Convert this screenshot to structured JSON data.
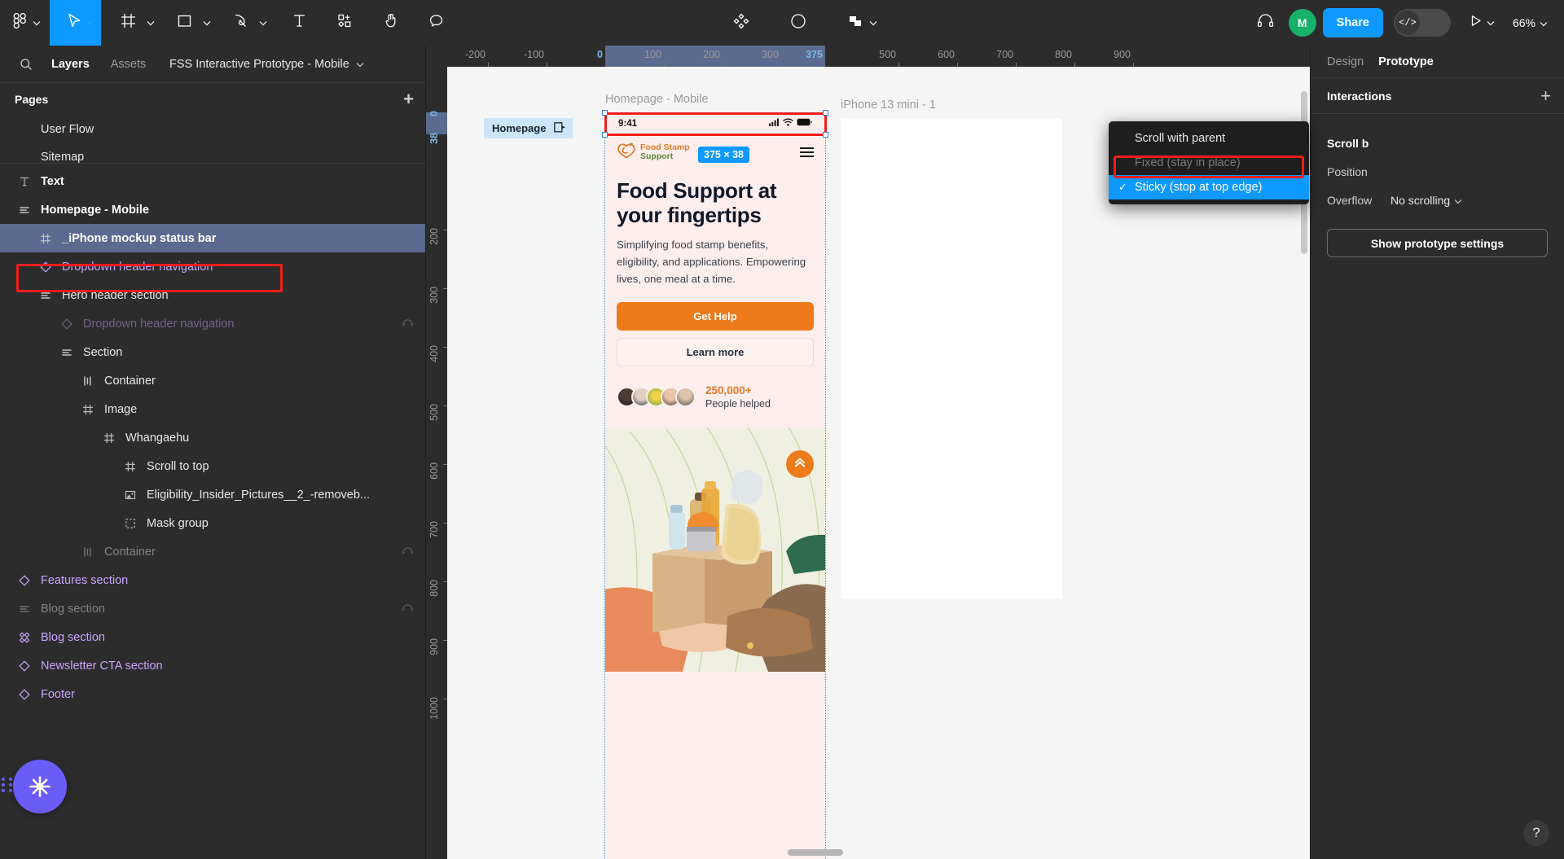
{
  "toolbar": {
    "menu_icon": "figma-logo-icon",
    "tools": [
      {
        "name": "move-tool",
        "icon": "cursor-icon",
        "active": true,
        "caret": true
      },
      {
        "name": "frame-tool",
        "icon": "frame-icon",
        "caret": true
      },
      {
        "name": "shape-tool",
        "icon": "square-icon",
        "caret": true
      },
      {
        "name": "pen-tool",
        "icon": "pen-icon",
        "caret": true
      },
      {
        "name": "text-tool",
        "icon": "text-icon",
        "caret": false
      },
      {
        "name": "actions-tool",
        "icon": "plugin-add-icon",
        "caret": false
      },
      {
        "name": "hand-tool",
        "icon": "hand-icon",
        "caret": false
      },
      {
        "name": "comment-tool",
        "icon": "comment-icon",
        "caret": false
      }
    ],
    "mid_tools": [
      {
        "name": "components-icon"
      },
      {
        "name": "contrast-icon"
      },
      {
        "name": "boolean-icon",
        "caret": true
      }
    ],
    "headphones_icon": "headphones-icon",
    "avatar_initial": "M",
    "share_label": "Share",
    "devmode_icon": "code-icon",
    "present_icon": "play-icon",
    "zoom_level": "66%"
  },
  "left_panel": {
    "search_icon": "search-icon",
    "tabs": [
      {
        "label": "Layers",
        "active": true
      },
      {
        "label": "Assets",
        "active": false
      }
    ],
    "file_name": "FSS Interactive Prototype - Mobile",
    "pages_header": "Pages",
    "pages_add_icon": "plus-icon",
    "pages": [
      {
        "label": "User Flow"
      },
      {
        "label": "Sitemap"
      }
    ],
    "layers": [
      {
        "label": "Text",
        "icon": "text-layer-icon",
        "indent": 0,
        "bold": true,
        "style": "normal"
      },
      {
        "label": "Homepage - Mobile",
        "icon": "autolayout-icon",
        "indent": 0,
        "bold": true,
        "style": "normal"
      },
      {
        "label": "_iPhone mockup status bar",
        "icon": "frame-layer-icon",
        "indent": 1,
        "bold": true,
        "style": "normal",
        "selected": true
      },
      {
        "label": "Dropdown header navigation",
        "icon": "component-icon",
        "indent": 1,
        "style": "component"
      },
      {
        "label": "Hero header section",
        "icon": "autolayout-icon",
        "indent": 1,
        "style": "normal"
      },
      {
        "label": "Dropdown header navigation",
        "icon": "component-icon",
        "indent": 2,
        "style": "component",
        "dim": true,
        "hidden_eye": true
      },
      {
        "label": "Section",
        "icon": "autolayout-icon",
        "indent": 2,
        "style": "normal"
      },
      {
        "label": "Container",
        "icon": "hstack-icon",
        "indent": 3,
        "style": "normal"
      },
      {
        "label": "Image",
        "icon": "frame-layer-icon",
        "indent": 3,
        "style": "normal"
      },
      {
        "label": "Whangaehu",
        "icon": "frame-layer-icon",
        "indent": 4,
        "style": "normal"
      },
      {
        "label": "Scroll to top",
        "icon": "frame-layer-icon",
        "indent": 5,
        "style": "normal"
      },
      {
        "label": "Eligibility_Insider_Pictures__2_-removeb...",
        "icon": "image-icon",
        "indent": 5,
        "style": "normal"
      },
      {
        "label": "Mask group",
        "icon": "mask-icon",
        "indent": 5,
        "style": "normal"
      },
      {
        "label": "Container",
        "icon": "hstack-icon",
        "indent": 3,
        "style": "normal",
        "dim": true,
        "hidden_eye": true
      },
      {
        "label": "Features section",
        "icon": "component-icon",
        "indent": 0,
        "style": "component"
      },
      {
        "label": "Blog section",
        "icon": "autolayout-icon",
        "indent": 0,
        "style": "normal",
        "dim": true,
        "hidden_eye": true
      },
      {
        "label": "Blog section",
        "icon": "variant-icon",
        "indent": 0,
        "style": "component"
      },
      {
        "label": "Newsletter CTA section",
        "icon": "component-icon",
        "indent": 0,
        "style": "component"
      },
      {
        "label": "Footer",
        "icon": "component-icon",
        "indent": 0,
        "style": "component"
      }
    ],
    "plugin_icon": "plugin-sparkle-icon"
  },
  "canvas": {
    "ruler_h_ticks": [
      "-200",
      "-100",
      "0",
      "100",
      "200",
      "300",
      "375",
      "500",
      "600",
      "700",
      "800",
      "900"
    ],
    "ruler_h_accent": [
      "0",
      "375"
    ],
    "ruler_v_ticks": [
      "0",
      "38",
      "200",
      "300",
      "400",
      "500",
      "600",
      "700",
      "800",
      "900",
      "1000"
    ],
    "ruler_v_accent": [
      "0",
      "38"
    ],
    "frame1_label": "Homepage - Mobile",
    "frame2_label": "iPhone 13 mini - 1",
    "selection_badge": "375 × 38",
    "prototype_chip_label": "Homepage",
    "prototype_chip_icon": "flow-start-icon"
  },
  "phone": {
    "status_time": "9:41",
    "status_icons": [
      "cellular-icon",
      "wifi-icon",
      "battery-icon"
    ],
    "brand_line1": "Food Stamp",
    "brand_line2": "Support",
    "brand_logo_icon": "heart-leaf-logo-icon",
    "menu_icon": "hamburger-icon",
    "hero_title": "Food Support at your fingertips",
    "hero_subtitle": "Simplifying food stamp benefits, eligibility, and applications. Empowering lives, one meal at a time.",
    "primary_cta": "Get Help",
    "secondary_cta": "Learn more",
    "stat_number": "250,000+",
    "stat_label": "People helped",
    "fab_icon": "double-chevron-up-icon"
  },
  "right_panel": {
    "tabs": [
      {
        "label": "Design",
        "active": false
      },
      {
        "label": "Prototype",
        "active": true
      }
    ],
    "interactions_title": "Interactions",
    "interactions_add_icon": "plus-icon",
    "scroll_behavior_label": "Scroll b",
    "position_label": "Position",
    "overflow_label": "Overflow",
    "overflow_value": "No scrolling",
    "show_settings_label": "Show prototype settings",
    "dropdown": {
      "items": [
        {
          "label": "Scroll with parent",
          "state": "normal"
        },
        {
          "label": "Fixed (stay in place)",
          "state": "disabled"
        },
        {
          "label": "Sticky (stop at top edge)",
          "state": "selected",
          "check": "✓"
        }
      ]
    }
  },
  "help_icon": "question-mark-icon"
}
